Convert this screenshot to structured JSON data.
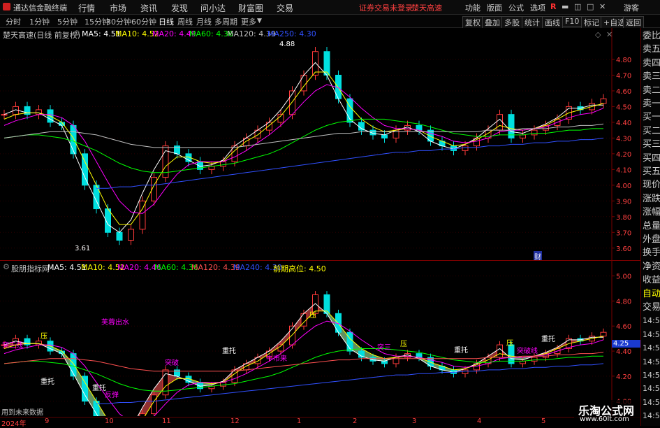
{
  "menubar": {
    "app_name": "通达信金融终端",
    "items": [
      "行情",
      "市场",
      "资讯",
      "发现",
      "问小达",
      "财富圈",
      "交易"
    ],
    "status": "证券交易未登录",
    "stock": "楚天高速",
    "right_items": [
      "功能",
      "版面",
      "公式",
      "选项"
    ],
    "user": "游客"
  },
  "toolbar": {
    "periods": [
      "分时",
      "1分钟",
      "5分钟",
      "15分钟",
      "30分钟",
      "60分钟",
      "日线",
      "周线",
      "月线",
      "多周期",
      "更多"
    ],
    "active": "日线",
    "right_buttons": [
      "复权",
      "叠加",
      "多股",
      "统计",
      "画线",
      "F10",
      "标记",
      "+自选",
      "返回"
    ]
  },
  "main_panel": {
    "title": "楚天高速(日线 前复权)",
    "ma": [
      {
        "label": "MA5: 4.51",
        "color": "#ffffff"
      },
      {
        "label": "MA10: 4.52",
        "color": "#ffff00"
      },
      {
        "label": "MA20: 4.49",
        "color": "#ff00ff"
      },
      {
        "label": "MA60: 4.36",
        "color": "#00ff00"
      },
      {
        "label": "MA120: 4.39",
        "color": "#c0c0c0"
      },
      {
        "label": "MA250: 4.30",
        "color": "#3050ff"
      }
    ],
    "high_label": "4.88",
    "low_label": "3.61",
    "fin_marker": "财"
  },
  "sub_panel": {
    "title": "股朋指标网",
    "ma": [
      {
        "label": "MA5: 4.51",
        "color": "#ffffff"
      },
      {
        "label": "MA10: 4.52",
        "color": "#ffff00"
      },
      {
        "label": "MA20: 4.46",
        "color": "#ff00ff"
      },
      {
        "label": "MA60: 4.36",
        "color": "#00ff00"
      },
      {
        "label": "MA120: 4.39",
        "color": "#ff5050"
      },
      {
        "label": "MA240: 4.30",
        "color": "#3050ff"
      },
      {
        "label": "前期高位: 4.50",
        "color": "#ffff00"
      }
    ],
    "annotations": [
      {
        "text": "芙蓉出水",
        "color": "#ff00ff"
      },
      {
        "text": "突三线",
        "color": "#ff00ff"
      },
      {
        "text": "重托",
        "color": "#ffffff"
      },
      {
        "text": "重托",
        "color": "#ffffff"
      },
      {
        "text": "反弹",
        "color": "#ff00ff"
      },
      {
        "text": "重托",
        "color": "#ffffff"
      },
      {
        "text": "压",
        "color": "#ffff00"
      },
      {
        "text": "压",
        "color": "#ffff00"
      },
      {
        "text": "压",
        "color": "#ffff00"
      },
      {
        "text": "压",
        "color": "#ffff00"
      },
      {
        "text": "牛市来",
        "color": "#ff00ff"
      },
      {
        "text": "重托",
        "color": "#ffffff"
      },
      {
        "text": "重托",
        "color": "#ffffff"
      },
      {
        "text": "突破线",
        "color": "#ff00ff"
      },
      {
        "text": "突破",
        "color": "#ff00ff"
      },
      {
        "text": "突三",
        "color": "#ff00ff"
      }
    ],
    "footer_note": "用到未来数据",
    "price_tag": "4.25"
  },
  "date_axis": {
    "labels": [
      "2024年",
      "9",
      "10",
      "11",
      "12",
      "1",
      "2",
      "3",
      "4",
      "5"
    ]
  },
  "right_panel": {
    "labels": [
      "委比",
      "卖五",
      "卖四",
      "卖三",
      "卖二",
      "卖一",
      "买一",
      "买二",
      "买三",
      "买四",
      "买五",
      "现价",
      "涨跌",
      "涨幅",
      "总量",
      "外盘",
      "换手",
      "净资",
      "收益",
      "自动",
      "交易",
      "14:56",
      "14:56",
      "14:56",
      "14:56",
      "14:56",
      "14:56",
      "14:56",
      "14:56"
    ]
  },
  "watermark": {
    "line1": "乐淘公式网",
    "line2": "www.60lt.com"
  },
  "chart_data": [
    {
      "type": "line",
      "name": "main_kline",
      "x_range": [
        "2024-08",
        "2025-05"
      ],
      "ylim": [
        3.55,
        4.92
      ],
      "y_ticks": [
        4.8,
        4.7,
        4.6,
        4.5,
        4.4,
        4.3,
        4.2,
        4.1,
        4.0,
        3.9,
        3.8,
        3.7,
        3.6
      ],
      "close": [
        4.45,
        4.5,
        4.45,
        4.48,
        4.4,
        4.38,
        4.2,
        4.0,
        3.85,
        3.7,
        3.65,
        3.72,
        3.9,
        4.05,
        4.25,
        4.2,
        4.15,
        4.1,
        4.12,
        4.15,
        4.25,
        4.3,
        4.35,
        4.4,
        4.45,
        4.6,
        4.7,
        4.85,
        4.7,
        4.55,
        4.4,
        4.35,
        4.32,
        4.3,
        4.35,
        4.38,
        4.35,
        4.28,
        4.25,
        4.22,
        4.25,
        4.3,
        4.35,
        4.45,
        4.3,
        4.32,
        4.35,
        4.38,
        4.42,
        4.5,
        4.48,
        4.52,
        4.55
      ],
      "series": [
        {
          "name": "MA5",
          "color": "#ffffff",
          "values": [
            4.45,
            4.48,
            4.46,
            4.46,
            4.42,
            4.38,
            4.22,
            4.05,
            3.9,
            3.75,
            3.7,
            3.78,
            3.95,
            4.1,
            4.22,
            4.2,
            4.16,
            4.12,
            4.13,
            4.16,
            4.25,
            4.3,
            4.35,
            4.4,
            4.48,
            4.58,
            4.7,
            4.78,
            4.7,
            4.55,
            4.42,
            4.36,
            4.33,
            4.32,
            4.35,
            4.37,
            4.34,
            4.28,
            4.25,
            4.23,
            4.26,
            4.3,
            4.36,
            4.42,
            4.34,
            4.33,
            4.36,
            4.39,
            4.43,
            4.49,
            4.49,
            4.51,
            4.51
          ]
        },
        {
          "name": "MA10",
          "color": "#ffff00",
          "values": [
            4.42,
            4.45,
            4.46,
            4.46,
            4.44,
            4.4,
            4.3,
            4.15,
            4.0,
            3.85,
            3.75,
            3.75,
            3.85,
            4.0,
            4.12,
            4.18,
            4.18,
            4.15,
            4.14,
            4.15,
            4.22,
            4.28,
            4.32,
            4.38,
            4.44,
            4.53,
            4.63,
            4.72,
            4.72,
            4.62,
            4.5,
            4.42,
            4.37,
            4.34,
            4.35,
            4.36,
            4.35,
            4.31,
            4.28,
            4.25,
            4.26,
            4.29,
            4.33,
            4.38,
            4.36,
            4.35,
            4.36,
            4.38,
            4.42,
            4.46,
            4.48,
            4.5,
            4.52
          ]
        },
        {
          "name": "MA20",
          "color": "#ff00ff",
          "values": [
            4.38,
            4.41,
            4.43,
            4.45,
            4.45,
            4.43,
            4.38,
            4.28,
            4.15,
            4.02,
            3.9,
            3.83,
            3.82,
            3.88,
            3.98,
            4.07,
            4.13,
            4.15,
            4.15,
            4.15,
            4.18,
            4.22,
            4.27,
            4.32,
            4.38,
            4.45,
            4.53,
            4.6,
            4.64,
            4.62,
            4.56,
            4.49,
            4.43,
            4.38,
            4.36,
            4.36,
            4.35,
            4.33,
            4.31,
            4.28,
            4.27,
            4.28,
            4.3,
            4.34,
            4.35,
            4.35,
            4.36,
            4.37,
            4.4,
            4.43,
            4.45,
            4.46,
            4.49
          ]
        },
        {
          "name": "MA60",
          "color": "#00ff00",
          "values": [
            4.3,
            4.31,
            4.32,
            4.32,
            4.31,
            4.3,
            4.28,
            4.25,
            4.22,
            4.18,
            4.14,
            4.11,
            4.09,
            4.08,
            4.08,
            4.09,
            4.1,
            4.11,
            4.12,
            4.13,
            4.14,
            4.16,
            4.18,
            4.2,
            4.23,
            4.27,
            4.31,
            4.35,
            4.38,
            4.4,
            4.41,
            4.42,
            4.42,
            4.42,
            4.41,
            4.4,
            4.39,
            4.37,
            4.35,
            4.33,
            4.32,
            4.31,
            4.31,
            4.32,
            4.32,
            4.32,
            4.33,
            4.33,
            4.34,
            4.35,
            4.35,
            4.36,
            4.36
          ]
        },
        {
          "name": "MA120",
          "color": "#c0c0c0",
          "values": [
            4.3,
            4.31,
            4.32,
            4.33,
            4.34,
            4.34,
            4.34,
            4.33,
            4.32,
            4.3,
            4.28,
            4.26,
            4.25,
            4.24,
            4.24,
            4.24,
            4.24,
            4.24,
            4.24,
            4.24,
            4.24,
            4.25,
            4.26,
            4.27,
            4.28,
            4.29,
            4.3,
            4.31,
            4.32,
            4.33,
            4.33,
            4.34,
            4.34,
            4.34,
            4.34,
            4.34,
            4.34,
            4.34,
            4.34,
            4.34,
            4.34,
            4.34,
            4.35,
            4.35,
            4.35,
            4.36,
            4.36,
            4.36,
            4.37,
            4.37,
            4.38,
            4.38,
            4.39
          ]
        },
        {
          "name": "MA250",
          "color": "#3050ff",
          "values": [
            null,
            null,
            null,
            null,
            null,
            null,
            null,
            null,
            3.98,
            3.98,
            3.99,
            3.99,
            4.0,
            4.0,
            4.01,
            4.02,
            4.03,
            4.04,
            4.05,
            4.06,
            4.07,
            4.08,
            4.09,
            4.1,
            4.11,
            4.12,
            4.13,
            4.14,
            4.15,
            4.16,
            4.17,
            4.18,
            4.19,
            4.2,
            4.21,
            4.21,
            4.22,
            4.22,
            4.23,
            4.23,
            4.24,
            4.24,
            4.25,
            4.25,
            4.26,
            4.26,
            4.27,
            4.27,
            4.28,
            4.28,
            4.29,
            4.29,
            4.3
          ]
        }
      ]
    },
    {
      "type": "line",
      "name": "sub_indicator",
      "ylim": [
        3.92,
        5.02
      ],
      "y_ticks": [
        5.0,
        4.8,
        4.6,
        4.4,
        4.2,
        4.0
      ],
      "price_tag": 4.25
    }
  ]
}
